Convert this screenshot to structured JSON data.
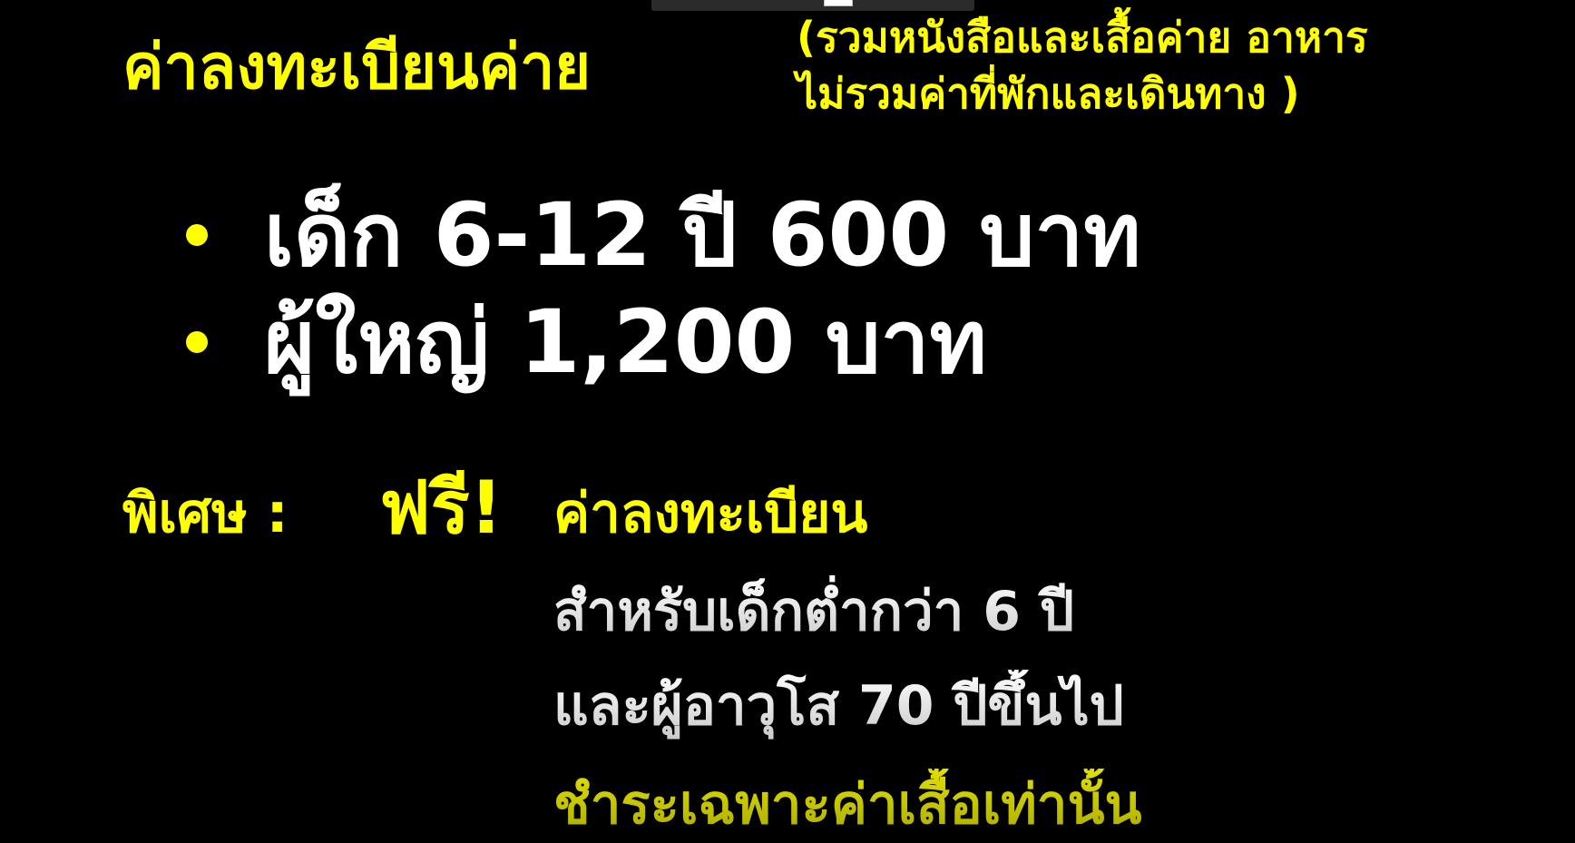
{
  "colors": {
    "background": "#000000",
    "accent_yellow": "#ffff00",
    "body_white": "#ffffff",
    "muted_yellow": "#c8c800"
  },
  "slide": {
    "title": "ค่าลงทะเบียนค่าย",
    "subtitle_line1": "(รวมหนังสือและเสื้อค่าย อาหาร",
    "subtitle_line2": "ไม่รวมค่าที่พักและเดินทาง )",
    "bullets": [
      {
        "text": "เด็ก 6-12 ปี 600 บาท"
      },
      {
        "text": "ผู้ใหญ่ 1,200 บาท"
      }
    ],
    "special": {
      "label": "พิเศษ :",
      "free_word": "ฟรี!",
      "fee_label": "ค่าลงทะเบียน",
      "line1": "สำหรับเด็กต่ำกว่า 6 ปี",
      "line2": "และผู้อาวุโส 70 ปีขึ้นไป",
      "line3": "ชำระเฉพาะค่าเสื้อเท่านั้น"
    }
  }
}
